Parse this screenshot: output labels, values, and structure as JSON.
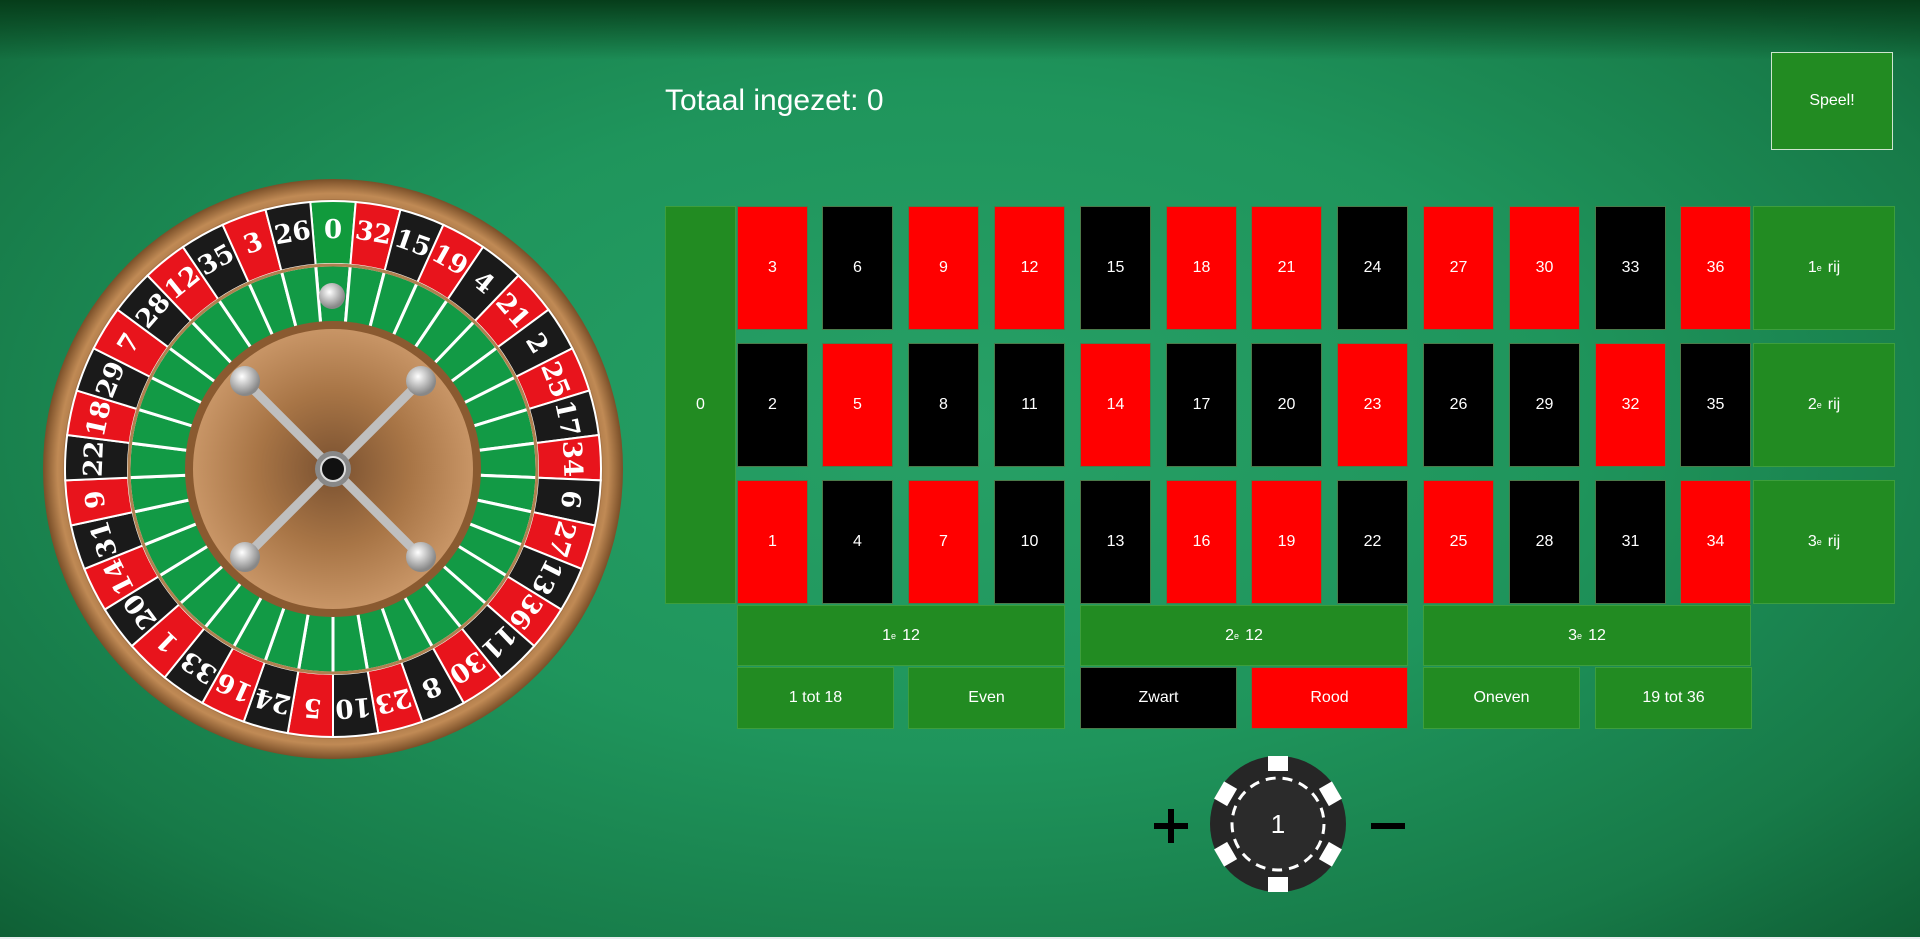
{
  "total": {
    "label": "Totaal ingezet:",
    "value": "0"
  },
  "spin_button": "Speel!",
  "zero": "0",
  "grid": {
    "rows": [
      [
        {
          "n": "3",
          "c": "red"
        },
        {
          "n": "6",
          "c": "black"
        },
        {
          "n": "9",
          "c": "red"
        },
        {
          "n": "12",
          "c": "red"
        },
        {
          "n": "15",
          "c": "black"
        },
        {
          "n": "18",
          "c": "red"
        },
        {
          "n": "21",
          "c": "red"
        },
        {
          "n": "24",
          "c": "black"
        },
        {
          "n": "27",
          "c": "red"
        },
        {
          "n": "30",
          "c": "red"
        },
        {
          "n": "33",
          "c": "black"
        },
        {
          "n": "36",
          "c": "red"
        }
      ],
      [
        {
          "n": "2",
          "c": "black"
        },
        {
          "n": "5",
          "c": "red"
        },
        {
          "n": "8",
          "c": "black"
        },
        {
          "n": "11",
          "c": "black"
        },
        {
          "n": "14",
          "c": "red"
        },
        {
          "n": "17",
          "c": "black"
        },
        {
          "n": "20",
          "c": "black"
        },
        {
          "n": "23",
          "c": "red"
        },
        {
          "n": "26",
          "c": "black"
        },
        {
          "n": "29",
          "c": "black"
        },
        {
          "n": "32",
          "c": "red"
        },
        {
          "n": "35",
          "c": "black"
        }
      ],
      [
        {
          "n": "1",
          "c": "red"
        },
        {
          "n": "4",
          "c": "black"
        },
        {
          "n": "7",
          "c": "red"
        },
        {
          "n": "10",
          "c": "black"
        },
        {
          "n": "13",
          "c": "black"
        },
        {
          "n": "16",
          "c": "red"
        },
        {
          "n": "19",
          "c": "red"
        },
        {
          "n": "22",
          "c": "black"
        },
        {
          "n": "25",
          "c": "red"
        },
        {
          "n": "28",
          "c": "black"
        },
        {
          "n": "31",
          "c": "black"
        },
        {
          "n": "34",
          "c": "red"
        }
      ]
    ],
    "row_bets": [
      {
        "ord": "1",
        "sup": "e",
        "label": "rij"
      },
      {
        "ord": "2",
        "sup": "e",
        "label": "rij"
      },
      {
        "ord": "3",
        "sup": "e",
        "label": "rij"
      }
    ],
    "dozens": [
      {
        "ord": "1",
        "sup": "e",
        "label": "12"
      },
      {
        "ord": "2",
        "sup": "e",
        "label": "12"
      },
      {
        "ord": "3",
        "sup": "e",
        "label": "12"
      }
    ],
    "outside": [
      {
        "label": "1 tot 18",
        "c": "green"
      },
      {
        "label": "Even",
        "c": "green"
      },
      {
        "label": "Zwart",
        "c": "black"
      },
      {
        "label": "Rood",
        "c": "red"
      },
      {
        "label": "Oneven",
        "c": "green"
      },
      {
        "label": "19 tot 36",
        "c": "green"
      }
    ]
  },
  "wheel": {
    "numbers": [
      0,
      32,
      15,
      19,
      4,
      21,
      2,
      25,
      17,
      34,
      6,
      27,
      13,
      36,
      11,
      30,
      8,
      23,
      10,
      5,
      24,
      16,
      33,
      1,
      20,
      14,
      31,
      9,
      22,
      18,
      29,
      7,
      28,
      12,
      35,
      3,
      26
    ]
  },
  "chip": {
    "value": "1",
    "plus_icon": "plus-icon",
    "minus_icon": "minus-icon"
  },
  "colors": {
    "red": "#ff0000",
    "black": "#000000",
    "green": "#228b22",
    "felt": "#1f955c"
  }
}
